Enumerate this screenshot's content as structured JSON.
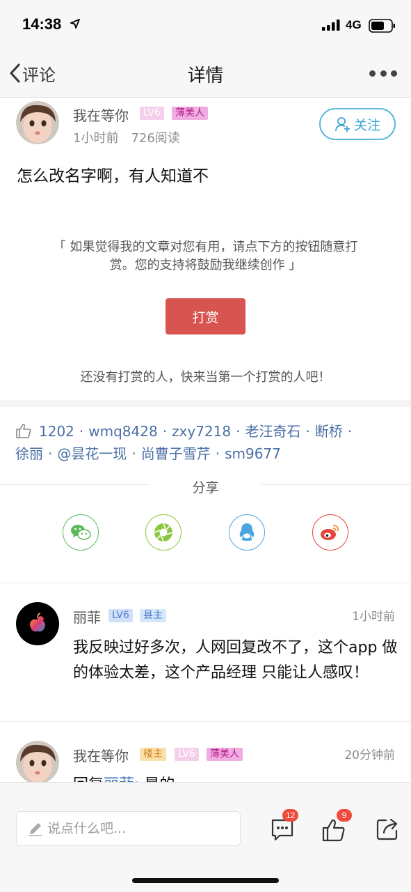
{
  "status_bar": {
    "time": "14:38",
    "network": "4G"
  },
  "nav": {
    "back_label": "评论",
    "title": "详情"
  },
  "post": {
    "author": {
      "name": "我在等你",
      "level": "LV6",
      "title_badge": "薄美人",
      "time_ago": "1小时前",
      "reads": "726阅读"
    },
    "follow_label": "关注",
    "content": "怎么改名字啊，有人知道不",
    "reward_note_line1": "「 如果觉得我的文章对您有用，请点下方的按钮随意打",
    "reward_note_line2": "赏。您的支持将鼓励我继续创作 」",
    "reward_button": "打赏",
    "reward_empty": "还没有打赏的人，快来当第一个打赏的人吧！"
  },
  "likes": {
    "count": "1202",
    "users": [
      "wmq8428",
      "zxy7218",
      "老汪奇石",
      "断桥",
      "徐丽",
      "@昙花一现",
      "尚曹子雪芹",
      "sm9677"
    ]
  },
  "share": {
    "title": "分享",
    "targets": [
      {
        "name": "wechat",
        "color": "#59b95a"
      },
      {
        "name": "moments",
        "color": "#8cc63f"
      },
      {
        "name": "qq",
        "color": "#4aa6e0"
      },
      {
        "name": "weibo",
        "color": "#e2453c"
      }
    ]
  },
  "comments": [
    {
      "name": "丽菲",
      "level": "LV6",
      "badge": "县主",
      "time": "1小时前",
      "text": "我反映过好多次，人网回复改不了，这个app 做的体验太差，这个产品经理 只能让人感叹！"
    },
    {
      "name": "我在等你",
      "owner_badge": "楼主",
      "level": "LV6",
      "badge": "薄美人",
      "time": "20分钟前",
      "reply_prefix": "回复",
      "reply_to": "丽菲:",
      "text": " 是的"
    }
  ],
  "bottom_bar": {
    "input_placeholder": "说点什么吧...",
    "comment_count": "12",
    "like_count": "9"
  }
}
